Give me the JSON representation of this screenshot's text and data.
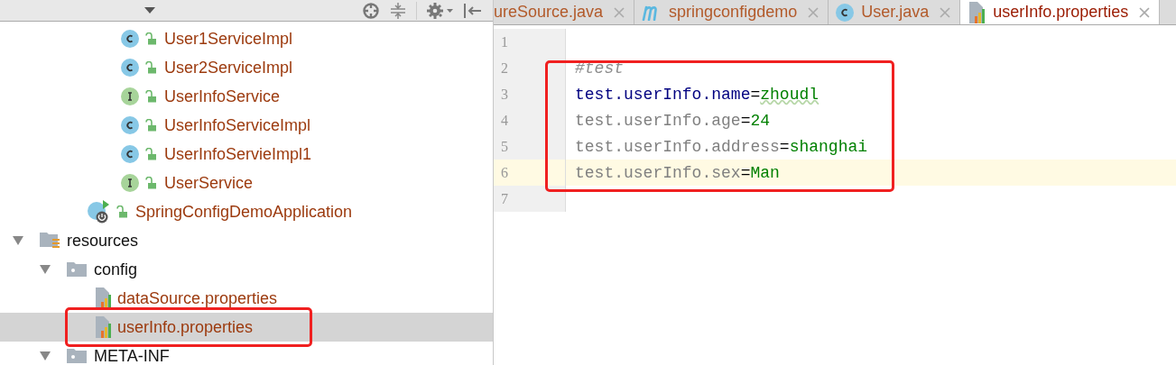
{
  "project_panel": {
    "tree": [
      {
        "children": [
          {
            "children": [
              {
                "children": [
                  {
                    "label": "User1ServiceImpl",
                    "kind": "class",
                    "selected": false
                  },
                  {
                    "label": "User2ServiceImpl",
                    "kind": "class",
                    "selected": false
                  },
                  {
                    "label": "UserInfoService",
                    "kind": "interface",
                    "selected": false
                  },
                  {
                    "label": "UserInfoServiceImpl",
                    "kind": "class",
                    "selected": false
                  },
                  {
                    "label": "UserInfoServieImpl1",
                    "kind": "class",
                    "selected": false
                  },
                  {
                    "label": "UserService",
                    "kind": "interface",
                    "selected": false
                  }
                ]
              },
              {
                "label": "SpringConfigDemoApplication",
                "kind": "app",
                "selected": false
              }
            ]
          }
        ]
      },
      {
        "label": "resources",
        "kind": "resources",
        "expanded": true,
        "selected": false,
        "children": [
          {
            "label": "config",
            "kind": "folder",
            "expanded": true,
            "selected": false,
            "children": [
              {
                "label": "dataSource.properties",
                "kind": "properties",
                "selected": false
              },
              {
                "label": "userInfo.properties",
                "kind": "properties",
                "selected": true
              }
            ]
          },
          {
            "label": "META-INF",
            "kind": "folder",
            "expanded": true,
            "selected": false
          }
        ]
      }
    ]
  },
  "editor": {
    "tabs": [
      {
        "label": "ureSource.java",
        "kind": "plain",
        "selected": false
      },
      {
        "label": "springconfigdemo",
        "kind": "maven",
        "selected": false
      },
      {
        "label": "User.java",
        "kind": "class",
        "selected": false
      },
      {
        "label": "userInfo.properties",
        "kind": "properties",
        "selected": true
      }
    ],
    "lines": [
      {
        "number": "1",
        "kind": "empty",
        "current": false
      },
      {
        "number": "2",
        "kind": "comment",
        "text": "#test",
        "current": false
      },
      {
        "number": "3",
        "kind": "property",
        "key": "test.userInfo.name",
        "sep": "=",
        "value": "zhoudl",
        "used": true,
        "current": false
      },
      {
        "number": "4",
        "kind": "property",
        "key": "test.userInfo.age",
        "sep": "=",
        "value": "24",
        "used": false,
        "current": false
      },
      {
        "number": "5",
        "kind": "property",
        "key": "test.userInfo.address",
        "sep": "=",
        "value": "shanghai",
        "used": false,
        "current": false
      },
      {
        "number": "6",
        "kind": "property",
        "key": "test.userInfo.sex",
        "sep": "=",
        "value": "Man",
        "used": false,
        "current": true
      },
      {
        "number": "7",
        "kind": "empty",
        "current": false
      }
    ]
  }
}
